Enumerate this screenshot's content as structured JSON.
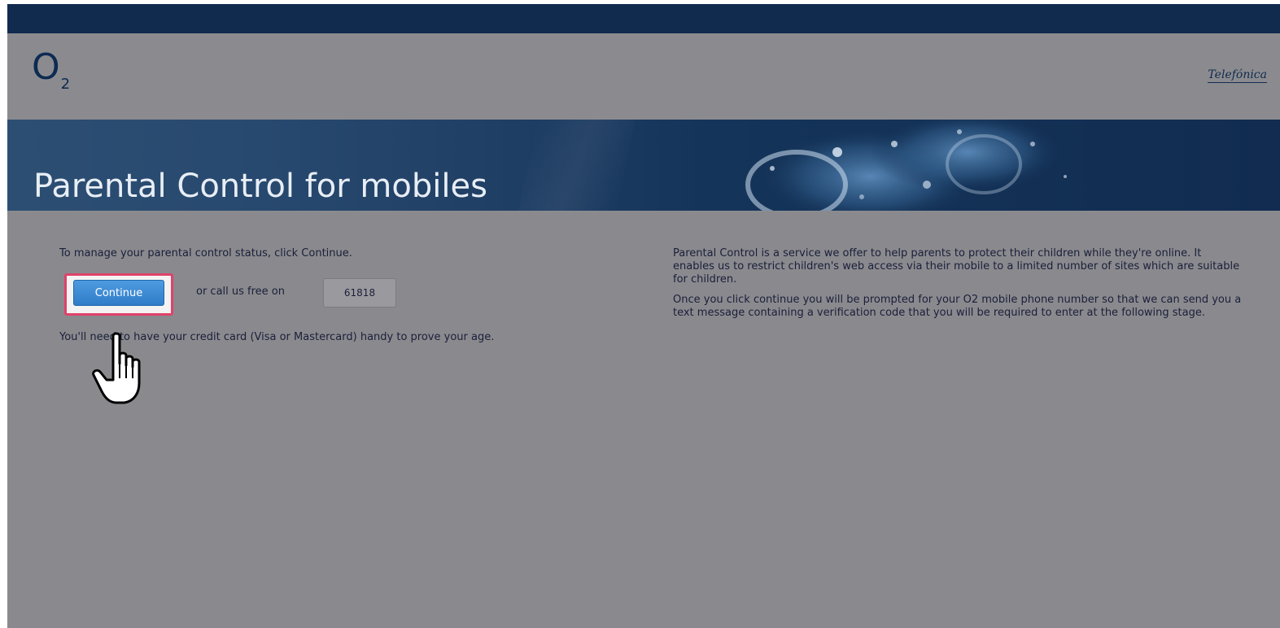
{
  "header": {
    "logo_main": "O",
    "logo_sub": "2",
    "partner_logo": "Telefónica"
  },
  "banner": {
    "title": "Parental Control for mobiles"
  },
  "left": {
    "instruction": "To manage your parental control status, click Continue.",
    "continue_label": "Continue",
    "call_text": "or call us free on",
    "phone_number": "61818",
    "credit_note": "You'll need to have your credit card (Visa or Mastercard) handy to prove your age."
  },
  "right": {
    "paragraph_1": "Parental Control is a service we offer to help parents to protect their children while they're online. It enables us to restrict children's web access via their mobile to a limited number of sites which are suitable for children.",
    "paragraph_2": "Once you click continue you will be prompted for your O2 mobile phone number so that we can send you a text message containing a verification code that you will be required to enter at the following stage."
  },
  "colors": {
    "topbar": "#102b4e",
    "page_background": "#8a8a8e",
    "button": "#3a88d4",
    "highlight": "#e0426a"
  },
  "icons": {
    "cursor": "hand-pointer-icon"
  }
}
